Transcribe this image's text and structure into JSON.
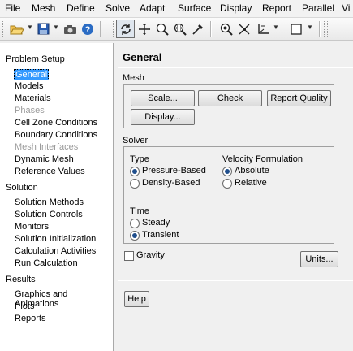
{
  "menubar": [
    "File",
    "Mesh",
    "Define",
    "Solve",
    "Adapt",
    "Surface",
    "Display",
    "Report",
    "Parallel",
    "Vi"
  ],
  "tree": {
    "problem_setup": {
      "label": "Problem Setup",
      "items": [
        {
          "label": "General",
          "state": "selected"
        },
        {
          "label": "Models",
          "state": "normal"
        },
        {
          "label": "Materials",
          "state": "normal"
        },
        {
          "label": "Phases",
          "state": "disabled"
        },
        {
          "label": "Cell Zone Conditions",
          "state": "normal"
        },
        {
          "label": "Boundary Conditions",
          "state": "normal"
        },
        {
          "label": "Mesh Interfaces",
          "state": "disabled"
        },
        {
          "label": "Dynamic Mesh",
          "state": "normal"
        },
        {
          "label": "Reference Values",
          "state": "normal"
        }
      ]
    },
    "solution": {
      "label": "Solution",
      "items": [
        "Solution Methods",
        "Solution Controls",
        "Monitors",
        "Solution Initialization",
        "Calculation Activities",
        "Run Calculation"
      ]
    },
    "results": {
      "label": "Results",
      "items": [
        "Graphics and Animations",
        "Plots",
        "Reports"
      ]
    }
  },
  "panel": {
    "title": "General",
    "mesh": {
      "label": "Mesh",
      "scale": "Scale...",
      "check": "Check",
      "report_quality": "Report Quality",
      "display": "Display..."
    },
    "solver": {
      "label": "Solver",
      "type_label": "Type",
      "type_options": [
        {
          "label": "Pressure-Based",
          "selected": true
        },
        {
          "label": "Density-Based",
          "selected": false
        }
      ],
      "velocity_label": "Velocity Formulation",
      "velocity_options": [
        {
          "label": "Absolute",
          "selected": true
        },
        {
          "label": "Relative",
          "selected": false
        }
      ],
      "time_label": "Time",
      "time_options": [
        {
          "label": "Steady",
          "selected": false
        },
        {
          "label": "Transient",
          "selected": true
        }
      ]
    },
    "gravity": {
      "label": "Gravity",
      "checked": false
    },
    "units": "Units...",
    "help": "Help"
  }
}
